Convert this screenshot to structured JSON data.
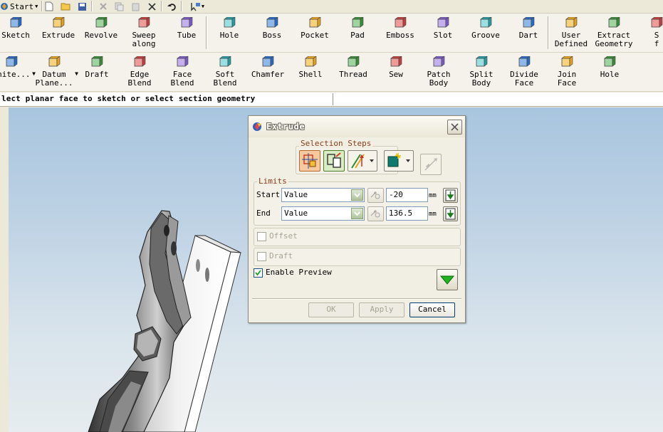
{
  "quick_access": {
    "start_label": "Start",
    "icons": [
      "new-file-icon",
      "open-folder-icon",
      "save-icon",
      "cut-icon",
      "copy-icon",
      "paste-icon",
      "delete-icon",
      "undo-icon",
      "pointer-options-icon"
    ]
  },
  "ribbon1": [
    {
      "name": "sketch",
      "label": "Sketch"
    },
    {
      "name": "extrude",
      "label": "Extrude"
    },
    {
      "name": "revolve",
      "label": "Revolve"
    },
    {
      "name": "sweep-along",
      "label": "Sweep\nalong"
    },
    {
      "name": "tube",
      "label": "Tube"
    },
    {
      "name": "hole",
      "label": "Hole"
    },
    {
      "name": "boss",
      "label": "Boss"
    },
    {
      "name": "pocket",
      "label": "Pocket"
    },
    {
      "name": "pad",
      "label": "Pad"
    },
    {
      "name": "emboss",
      "label": "Emboss"
    },
    {
      "name": "slot",
      "label": "Slot"
    },
    {
      "name": "groove",
      "label": "Groove"
    },
    {
      "name": "dart",
      "label": "Dart"
    },
    {
      "name": "user-defined",
      "label": "User\nDefined"
    },
    {
      "name": "extract-geometry",
      "label": "Extract\nGeometry"
    },
    {
      "name": "truncated",
      "label": "S\nf"
    }
  ],
  "ribbon2": [
    {
      "name": "unite",
      "label": "Unite..."
    },
    {
      "name": "datum-plane",
      "label": "Datum\nPlane..."
    },
    {
      "name": "draft",
      "label": "Draft"
    },
    {
      "name": "edge-blend",
      "label": "Edge\nBlend"
    },
    {
      "name": "face-blend",
      "label": "Face\nBlend"
    },
    {
      "name": "soft-blend",
      "label": "Soft\nBlend"
    },
    {
      "name": "chamfer",
      "label": "Chamfer"
    },
    {
      "name": "shell",
      "label": "Shell"
    },
    {
      "name": "thread",
      "label": "Thread"
    },
    {
      "name": "sew",
      "label": "Sew"
    },
    {
      "name": "patch-body",
      "label": "Patch\nBody"
    },
    {
      "name": "split-body",
      "label": "Split\nBody"
    },
    {
      "name": "divide-face",
      "label": "Divide\nFace"
    },
    {
      "name": "join-face",
      "label": "Join\nFace"
    },
    {
      "name": "hole2",
      "label": "Hole"
    }
  ],
  "prompt": "lect planar face to sketch or select section geometry",
  "dialog": {
    "title": "Extrude",
    "selection_steps_label": "Selection Steps",
    "limits_label": "Limits",
    "start_label": "Start",
    "start_type": "Value",
    "start_value": "-20",
    "end_label": "End",
    "end_type": "Value",
    "end_value": "136.5",
    "unit": "mm",
    "offset_label": "Offset",
    "draft_label": "Draft",
    "enable_preview_label": "Enable Preview",
    "enable_preview_checked": true,
    "ok_label": "OK",
    "apply_label": "Apply",
    "cancel_label": "Cancel"
  }
}
